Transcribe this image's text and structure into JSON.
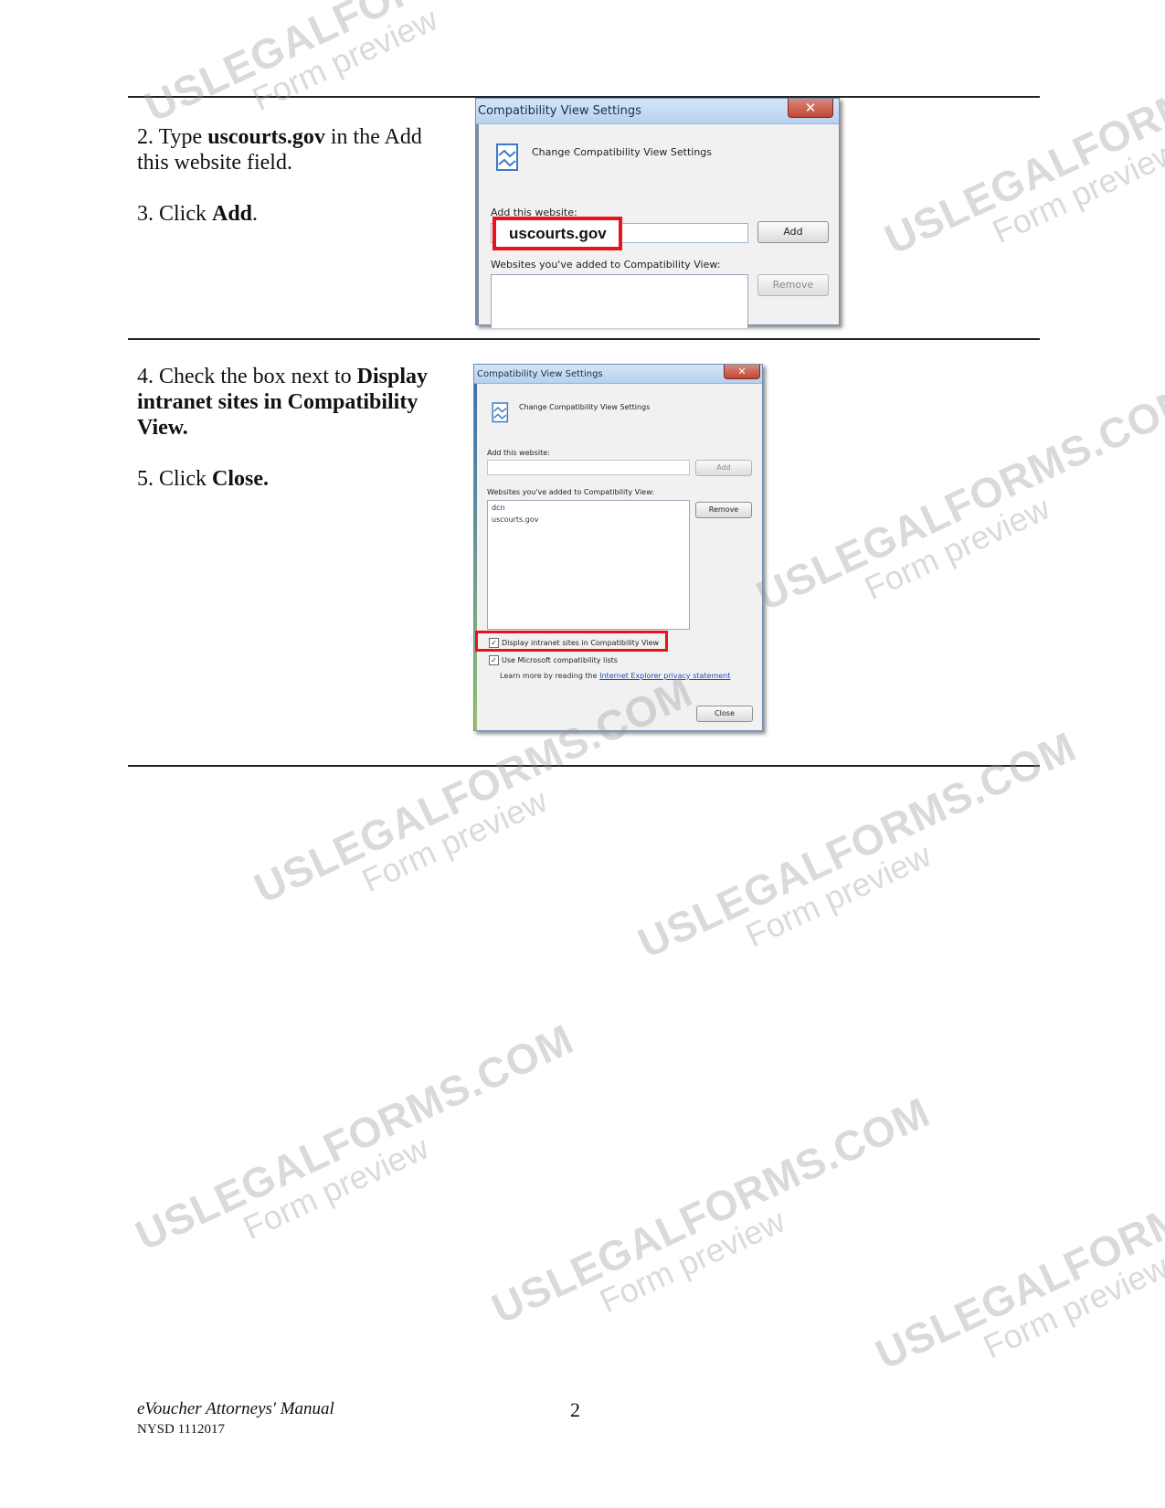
{
  "steps": [
    {
      "num": "2.",
      "parts": [
        {
          "text": " Type ",
          "bold": false
        },
        {
          "text": "uscourts.gov",
          "bold": true
        },
        {
          "text": " in the Add this website field.",
          "bold": false
        }
      ]
    },
    {
      "num": "3.",
      "parts": [
        {
          "text": " Click ",
          "bold": false
        },
        {
          "text": "Add",
          "bold": true
        },
        {
          "text": ".",
          "bold": false
        }
      ]
    },
    {
      "num": "4.",
      "parts": [
        {
          "text": " Check the box next to ",
          "bold": false
        },
        {
          "text": "Display intranet sites in Compatibility View.",
          "bold": true
        }
      ]
    },
    {
      "num": "5.",
      "parts": [
        {
          "text": " Click ",
          "bold": false
        },
        {
          "text": "Close.",
          "bold": true
        }
      ]
    }
  ],
  "dialog1": {
    "title": "Compatibility View Settings",
    "close_glyph": "✕",
    "heading": "Change Compatibility View Settings",
    "add_label": "Add this website:",
    "add_value": "uscourts.gov",
    "add_button": "Add",
    "list_label": "Websites you've added to Compatibility View:",
    "remove_button": "Remove"
  },
  "dialog2": {
    "title": "Compatibility View Settings",
    "close_glyph": "✕",
    "heading": "Change Compatibility View Settings",
    "add_label": "Add this website:",
    "add_button": "Add",
    "list_label": "Websites you've added to Compatibility View:",
    "list_items": [
      "dcn",
      "uscourts.gov"
    ],
    "remove_button": "Remove",
    "checkbox_intranet": "Display intranet sites in Compatibility View",
    "checkbox_microsoft": "Use Microsoft compatibility lists",
    "learn_prefix": "Learn more by reading the ",
    "learn_link": "Internet Explorer privacy statement",
    "close_button": "Close"
  },
  "footer": {
    "manual_title": "eVoucher Attorneys' Manual",
    "code": "NYSD 1112017",
    "page_number": "2"
  },
  "watermark": {
    "brand": "USLEGALFORMS.COM",
    "sub": "Form preview"
  }
}
